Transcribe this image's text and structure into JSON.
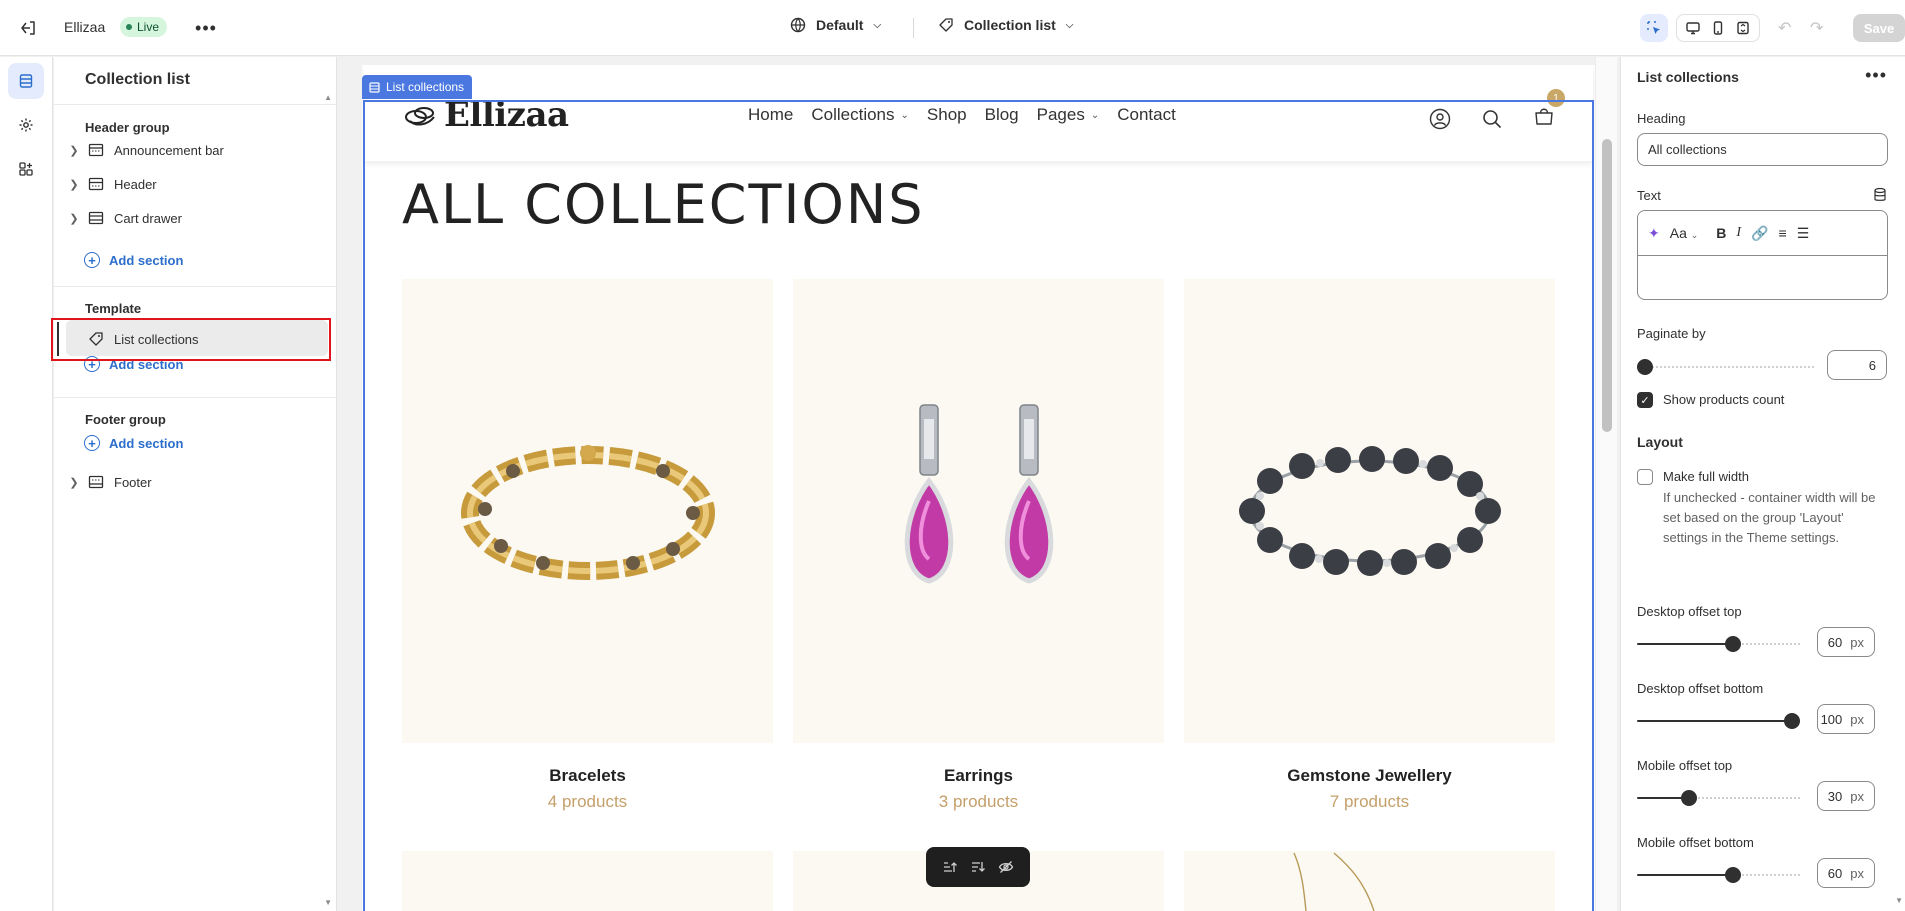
{
  "topbar": {
    "store_name": "Ellizaa",
    "status": "Live",
    "theme": "Default",
    "template": "Collection list",
    "save_label": "Save"
  },
  "sections_panel": {
    "title": "Collection list",
    "header_group": {
      "label": "Header group",
      "items": [
        {
          "label": "Announcement bar",
          "icon": "announcement-bar-icon"
        },
        {
          "label": "Header",
          "icon": "header-icon"
        },
        {
          "label": "Cart drawer",
          "icon": "cart-drawer-icon"
        }
      ],
      "add_label": "Add section"
    },
    "template_group": {
      "label": "Template",
      "items": [
        {
          "label": "List collections",
          "icon": "tag-icon",
          "selected": true
        }
      ],
      "add_label": "Add section"
    },
    "footer_group": {
      "label": "Footer group",
      "add_label": "Add section",
      "items": [
        {
          "label": "Footer",
          "icon": "footer-icon"
        }
      ]
    }
  },
  "preview": {
    "selected_label": "List collections",
    "logo": "Ellizaa",
    "nav": [
      "Home",
      "Collections",
      "Shop",
      "Blog",
      "Pages",
      "Contact"
    ],
    "cart_count": "1",
    "page_title": "ALL COLLECTIONS",
    "collections": [
      {
        "name": "Bracelets",
        "count": "4 products"
      },
      {
        "name": "Earrings",
        "count": "3 products"
      },
      {
        "name": "Gemstone Jewellery",
        "count": "7 products"
      }
    ]
  },
  "settings": {
    "title": "List collections",
    "heading_label": "Heading",
    "heading_value": "All collections",
    "text_label": "Text",
    "paginate_label": "Paginate by",
    "paginate_value": "6",
    "paginate_fraction": 0.0,
    "show_count_label": "Show products count",
    "show_count_checked": true,
    "layout_label": "Layout",
    "full_width_label": "Make full width",
    "full_width_checked": false,
    "full_width_help": "If unchecked - container width will be set based on the group 'Layout' settings in the Theme settings.",
    "offsets": [
      {
        "label": "Desktop offset top",
        "value": "60",
        "unit": "px",
        "fraction": 0.6
      },
      {
        "label": "Desktop offset bottom",
        "value": "100",
        "unit": "px",
        "fraction": 1.0
      },
      {
        "label": "Mobile offset top",
        "value": "30",
        "unit": "px",
        "fraction": 0.3
      },
      {
        "label": "Mobile offset bottom",
        "value": "60",
        "unit": "px",
        "fraction": 0.6
      }
    ]
  },
  "colors": {
    "accent": "#2c6ecb",
    "selection": "#4a78e0",
    "highlight_box": "#e0151b",
    "price_gold": "#c4a06a",
    "card_bg": "#fbf9f2"
  }
}
